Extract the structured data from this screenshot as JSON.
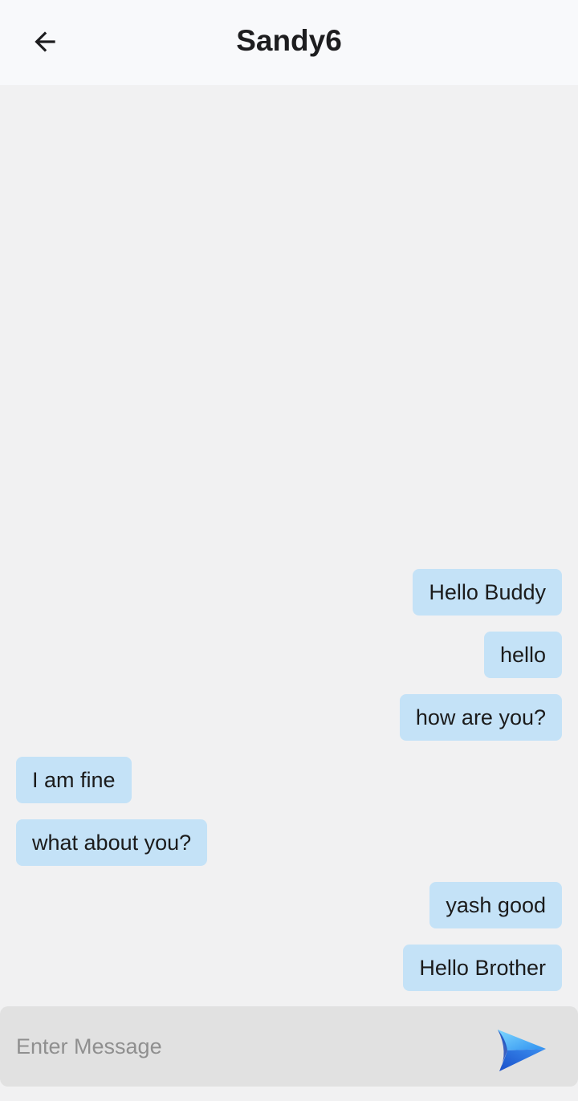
{
  "header": {
    "title": "Sandy6",
    "back_icon": "arrow-left-icon"
  },
  "messages": [
    {
      "text": "Hello Buddy",
      "side": "right"
    },
    {
      "text": "hello",
      "side": "right"
    },
    {
      "text": "how are you?",
      "side": "right"
    },
    {
      "text": "I am fine",
      "side": "left"
    },
    {
      "text": "what about you?",
      "side": "left"
    },
    {
      "text": "yash good",
      "side": "right"
    },
    {
      "text": "Hello Brother",
      "side": "right"
    }
  ],
  "composer": {
    "placeholder": "Enter Message",
    "value": "",
    "send_icon": "send-icon"
  },
  "colors": {
    "bubble": "#c4e2f7",
    "background": "#f1f1f2",
    "header": "#f8f9fb",
    "composer": "#e1e1e1",
    "send_light": "#6fd0ff",
    "send_dark": "#1e63e0"
  }
}
